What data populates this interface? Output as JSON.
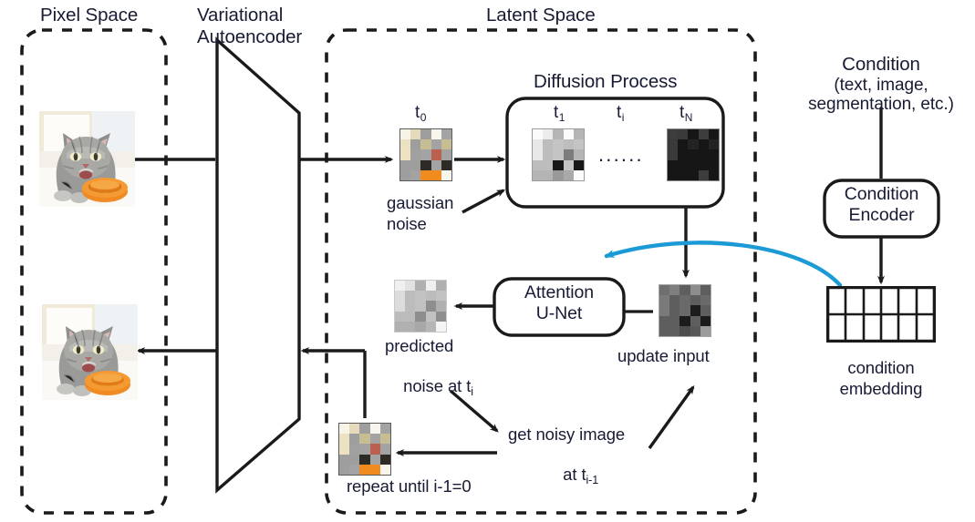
{
  "figure": {
    "type": "diagram",
    "title": "Latent diffusion model architecture",
    "accent_blue": "#1b9ad6",
    "ink": "#171b33",
    "line": "#1a1a1a"
  },
  "labels": {
    "pixel_space": "Pixel Space",
    "variational_autoencoder_l1": "Variational",
    "variational_autoencoder_l2": "Autoencoder",
    "latent_space": "Latent Space",
    "diffusion_process": "Diffusion Process",
    "gaussian_noise_l1": "gaussian",
    "gaussian_noise_l2": "noise",
    "attention_unet_l1": "Attention",
    "attention_unet_l2": "U-Net",
    "predicted_noise_l1": "predicted",
    "predicted_noise_l2": "noise at t",
    "predicted_noise_sub": "i",
    "update_input": "update input",
    "get_noisy_image_l1": "get noisy image",
    "get_noisy_image_l2": "at t",
    "get_noisy_image_sub": "i-1",
    "repeat_until": "repeat until i-1=0",
    "condition_l1": "Condition",
    "condition_l2": "(text, image,",
    "condition_l3": "segmentation, etc.)",
    "condition_encoder_l1": "Condition",
    "condition_encoder_l2": "Encoder",
    "condition_embedding_l1": "condition",
    "condition_embedding_l2": "embedding"
  },
  "timesteps": {
    "t0": {
      "base": "t",
      "sub": "0"
    },
    "t1": {
      "base": "t",
      "sub": "1"
    },
    "ti": {
      "base": "t",
      "sub": "i"
    },
    "tN": {
      "base": "t",
      "sub": "N"
    },
    "ellipsis": "......"
  },
  "grids": {
    "t0_latent": {
      "rows": 5,
      "cols": 5,
      "cells": [
        "#f7f3e6",
        "#e5dbbc",
        "#9e9e9e",
        "#f7f5ec",
        "#a3a3a3",
        "#ece2c2",
        "#9e9e9e",
        "#c6bd93",
        "#a3a3a3",
        "#c6bd93",
        "#ece2c2",
        "#a0a0a0",
        "#a3a3a3",
        "#bb5f4e",
        "#a3a3a3",
        "#9e9e9e",
        "#9e9e9e",
        "#2e2a26",
        "#a3a3a3",
        "#2e2a26",
        "#9e9e9e",
        "#a3a3a3",
        "#ef8b1f",
        "#ef8b1f",
        "#f7f5ec"
      ]
    },
    "t1_noisy": {
      "rows": 5,
      "cols": 5,
      "cells": [
        "#fbfbfb",
        "#ececec",
        "#b4b4b4",
        "#fbfbfb",
        "#b4b4b4",
        "#e8e8e8",
        "#bdbdbd",
        "#c4c4c4",
        "#bdbdbd",
        "#c4c4c4",
        "#e8e8e8",
        "#bdbdbd",
        "#c4c4c4",
        "#7c7c7c",
        "#b4b4b4",
        "#bdbdbd",
        "#bdbdbd",
        "#171717",
        "#c4c4c4",
        "#171717",
        "#b4b4b4",
        "#b4b4b4",
        "#999999",
        "#a9a9a9",
        "#fbfbfb"
      ]
    },
    "tN_noise": {
      "rows": 5,
      "cols": 5,
      "cells": [
        "#3d3d3d",
        "#3a3a3a",
        "#161616",
        "#3d3d3d",
        "#161616",
        "#3a3a3a",
        "#161616",
        "#242424",
        "#161616",
        "#242424",
        "#3a3a3a",
        "#161616",
        "#161616",
        "#161616",
        "#161616",
        "#161616",
        "#161616",
        "#161616",
        "#161616",
        "#161616",
        "#161616",
        "#161616",
        "#161616",
        "#3d3d3d",
        "#161616"
      ]
    },
    "predicted_noise": {
      "rows": 5,
      "cols": 5,
      "cells": [
        "#f0f0f0",
        "#e2e2e2",
        "#b0b0b0",
        "#f0f0f0",
        "#b0b0b0",
        "#dcdcdc",
        "#bcbcbc",
        "#c2c2c2",
        "#bcbcbc",
        "#c2c2c2",
        "#dcdcdc",
        "#bcbcbc",
        "#c2c2c2",
        "#8e8e8e",
        "#b0b0b0",
        "#bcbcbc",
        "#bcbcbc",
        "#8e8e8e",
        "#c2c2c2",
        "#8e8e8e",
        "#b0b0b0",
        "#b0b0b0",
        "#a8a8a8",
        "#b6b6b6",
        "#f4f4f4"
      ]
    },
    "update_input": {
      "rows": 5,
      "cols": 5,
      "cells": [
        "#6f6f6f",
        "#7f7f7f",
        "#5e5e5e",
        "#8d8d8d",
        "#5e5e5e",
        "#7a7a7a",
        "#5e5e5e",
        "#6a6a6a",
        "#5e5e5e",
        "#6a6a6a",
        "#7a7a7a",
        "#5e5e5e",
        "#6a6a6a",
        "#1c1c1c",
        "#5e5e5e",
        "#5e5e5e",
        "#5e5e5e",
        "#1c1c1c",
        "#5e5e5e",
        "#1c1c1c",
        "#5e5e5e",
        "#5e5e5e",
        "#4d4d4d",
        "#585858",
        "#9b9b9b"
      ]
    },
    "repeat_latent": {
      "rows": 5,
      "cols": 5,
      "cells": [
        "#f7f3e6",
        "#e5dbbc",
        "#9e9e9e",
        "#f7f5ec",
        "#a3a3a3",
        "#ece2c2",
        "#9e9e9e",
        "#c6bd93",
        "#a3a3a3",
        "#c6bd93",
        "#ece2c2",
        "#a0a0a0",
        "#a3a3a3",
        "#bb5f4e",
        "#a3a3a3",
        "#9e9e9e",
        "#9e9e9e",
        "#2e2a26",
        "#a3a3a3",
        "#2e2a26",
        "#9e9e9e",
        "#a3a3a3",
        "#ef8b1f",
        "#ef8b1f",
        "#f7f5ec"
      ]
    },
    "condition_embedding": {
      "rows": 2,
      "cols": 6,
      "cells": []
    }
  },
  "images": {
    "input_cat_alt": "photo of a grey tabby cat beside an orange bowl",
    "output_cat_alt": "photo of a grey tabby cat beside an orange bowl"
  }
}
